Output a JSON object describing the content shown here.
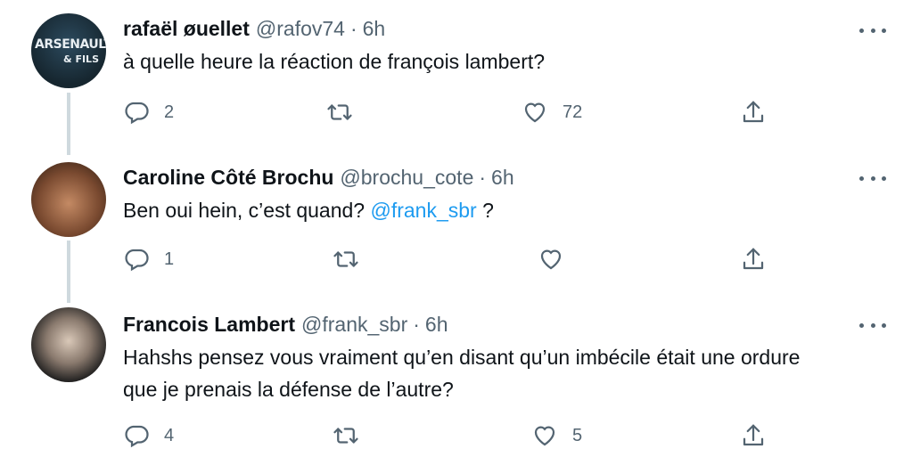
{
  "tweets": [
    {
      "name": "rafaël øuellet",
      "handle": "@rafov74",
      "time": "6h",
      "text_parts": [
        "à quelle heure la réaction de françois lambert?"
      ],
      "mention": "",
      "text_after": "",
      "replies": "2",
      "retweets": "",
      "likes": "72",
      "avatar_logo": [
        "ARSENAULT",
        "& FILS"
      ]
    },
    {
      "name": "Caroline Côté Brochu",
      "handle": "@brochu_cote",
      "time": "6h",
      "text_parts": [
        "Ben oui hein, c’est quand? "
      ],
      "mention": "@frank_sbr",
      "text_after": " ?",
      "replies": "1",
      "retweets": "",
      "likes": ""
    },
    {
      "name": "Francois Lambert",
      "handle": "@frank_sbr",
      "time": "6h",
      "text_parts": [
        "Hahshs pensez vous vraiment qu’en disant qu’un imbécile était une ordure que je prenais la défense de l’autre?"
      ],
      "mention": "",
      "text_after": "",
      "replies": "4",
      "retweets": "",
      "likes": "5"
    }
  ],
  "separator": "·",
  "icons": [
    "reply-icon",
    "retweet-icon",
    "like-icon",
    "share-icon",
    "more-icon"
  ],
  "colors": {
    "link": "#1d9bf0",
    "secondary": "#536471",
    "thread_line": "#cfd9de"
  }
}
